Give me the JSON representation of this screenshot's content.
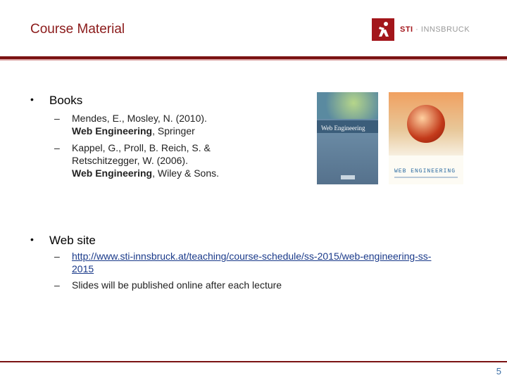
{
  "slide": {
    "title": "Course  Material",
    "page_number": "5"
  },
  "logo": {
    "brand": "STI",
    "sep": " · ",
    "place": "INNSBRUCK"
  },
  "books": {
    "heading": "Books",
    "items": [
      {
        "line1": "Mendes, E., Mosley, N. (2010).",
        "line2_bold": "Web Engineering",
        "line2_rest": ", Springer"
      },
      {
        "line1": "Kappel, G., Proll, B. Reich, S. &",
        "line2": "Retschitzegger, W. (2006).",
        "line3_bold": "Web Engineering",
        "line3_rest": ", Wiley & Sons."
      }
    ],
    "cover1_title": "Web Engineering",
    "cover2_title": "WEB ENGINEERING"
  },
  "website": {
    "heading": "Web site",
    "url_line1": "http://www.sti-innsbruck.at/teaching/course-schedule/ss-2015/web-engineering-ss-",
    "url_line2": "2015",
    "note": "Slides will be published online after each lecture"
  },
  "colors": {
    "accent": "#7a1212",
    "title": "#8b1a1a",
    "page_number": "#3a6ea5"
  }
}
